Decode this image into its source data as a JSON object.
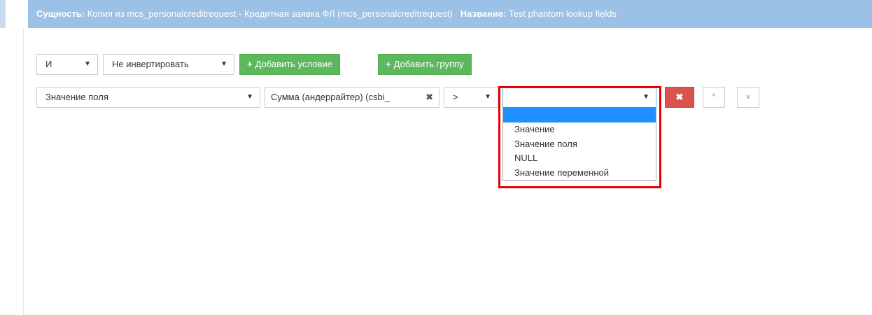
{
  "header": {
    "entity_label": "Сущность:",
    "entity_value": "Копия из mcs_personalcreditrequest - Кредитная заявка ФЛ (mcs_personalcreditrequest)",
    "name_label": "Название:",
    "name_value": "Test phantom lookup fields"
  },
  "group_row": {
    "operator_select": "И",
    "invert_select": "Не инвертировать",
    "add_condition_label": "Добавить условие",
    "add_group_label": "Добавить группу"
  },
  "condition_row": {
    "type_select": "Значение поля",
    "field_select": "Сумма (андеррайтер) (csbi_",
    "comparison_select": ">",
    "value_type_select": "",
    "value_type_options": [
      "",
      "Значение",
      "Значение поля",
      "NULL",
      "Значение переменной"
    ],
    "highlighted_option_index": 0
  },
  "icons": {
    "dropdown_arrow": "▼",
    "clear": "✖",
    "delete": "✖",
    "move_up": "^",
    "move_down": "v",
    "plus": "+"
  },
  "colors": {
    "header_bg": "#9cc1e6",
    "green_button": "#5cb85c",
    "red_button": "#d9534f",
    "highlight_option": "#1e90ff",
    "annotation_box": "#e60000"
  }
}
